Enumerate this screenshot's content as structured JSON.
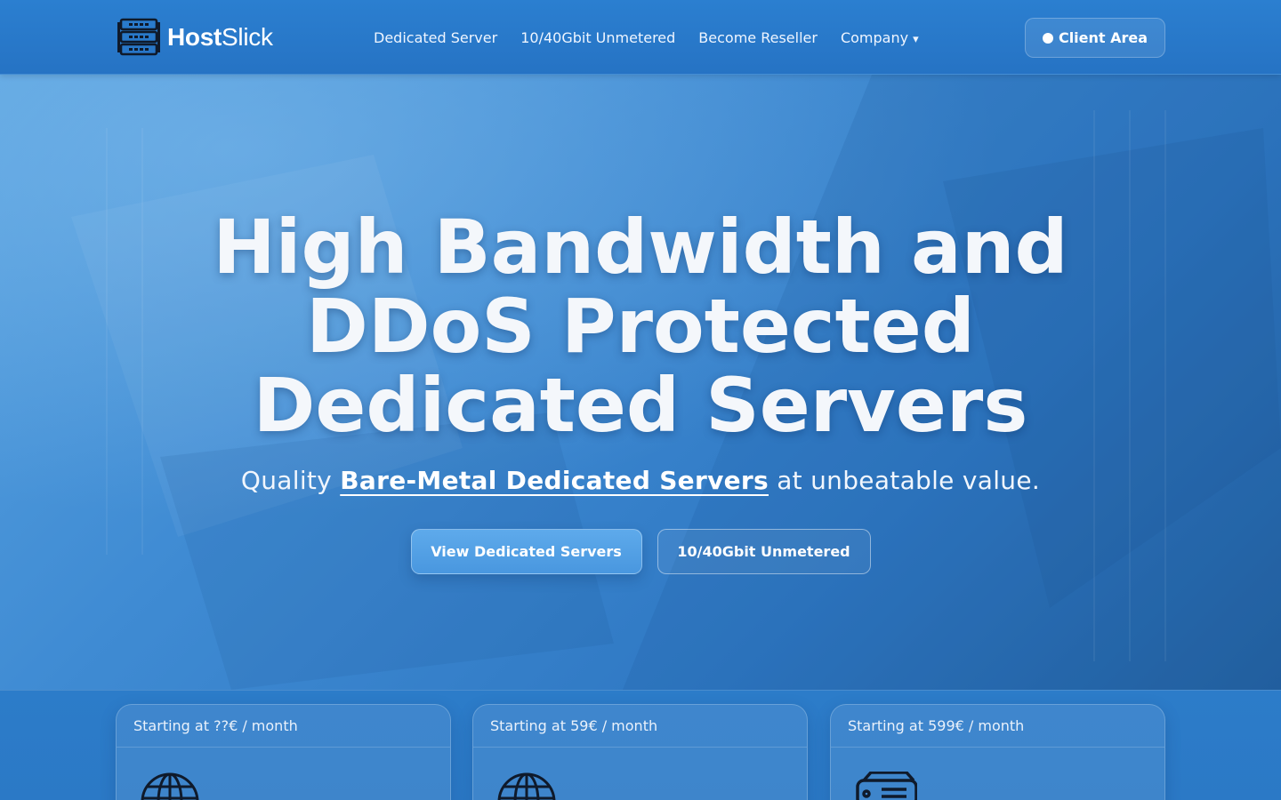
{
  "brand": {
    "name_bold": "Host",
    "name_light": "Slick",
    "logo_icon": "server-rack-icon"
  },
  "nav": {
    "links": [
      {
        "label": "Dedicated Server"
      },
      {
        "label": "10/40Gbit Unmetered"
      },
      {
        "label": "Become Reseller"
      },
      {
        "label": "Company",
        "caret": "▾"
      }
    ],
    "client_area": {
      "label": "Client Area",
      "icon": "status-dot-icon"
    }
  },
  "hero": {
    "title_lines": [
      "High Bandwidth and",
      "DDoS Protected",
      "Dedicated Servers"
    ],
    "subtitle_prefix": "Quality ",
    "subtitle_link": "Bare-Metal Dedicated Servers",
    "subtitle_suffix": " at unbeatable value.",
    "primary_button": "View Dedicated Servers",
    "secondary_button": "10/40Gbit Unmetered"
  },
  "cards": [
    {
      "header": "Starting at ??€ / month",
      "icon": "globe-icon"
    },
    {
      "header": "Starting at 59€ / month",
      "icon": "globe-icon"
    },
    {
      "header": "Starting at 599€ / month",
      "icon": "server-drive-icon"
    }
  ],
  "colors": {
    "nav_bg": "#2b7fd0",
    "hero_light": "#58a2e0",
    "hero_dark": "#23609f",
    "primary_button": "#5eaaeb",
    "text": "#ffffff"
  }
}
